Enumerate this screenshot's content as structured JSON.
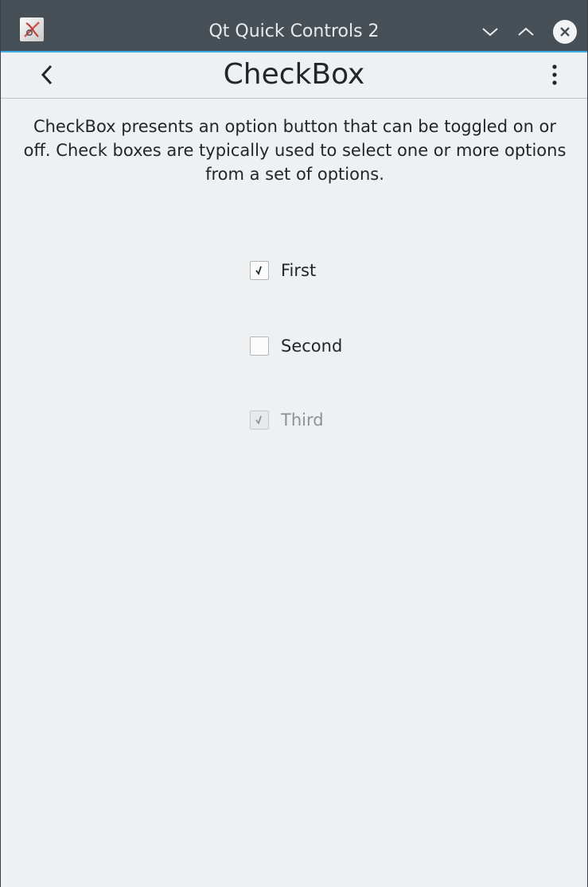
{
  "window": {
    "title": "Qt Quick Controls 2",
    "app_icon": "qt-app-icon",
    "controls": {
      "minimize": "chevron-down-icon",
      "maximize": "chevron-up-icon",
      "close": "close-icon"
    },
    "accent_color": "#3daee9",
    "titlebar_color": "#475057"
  },
  "toolbar": {
    "title": "CheckBox",
    "back_icon": "chevron-left-icon",
    "menu_icon": "kebab-menu-icon"
  },
  "page": {
    "description": "CheckBox presents an option button that can be toggled on or off. Check boxes are typically used to select one or more options from a set of options.",
    "background": "#eff0f1"
  },
  "checkboxes": [
    {
      "label": "First",
      "checked": true,
      "enabled": true
    },
    {
      "label": "Second",
      "checked": false,
      "enabled": true
    },
    {
      "label": "Third",
      "checked": true,
      "enabled": false
    }
  ]
}
